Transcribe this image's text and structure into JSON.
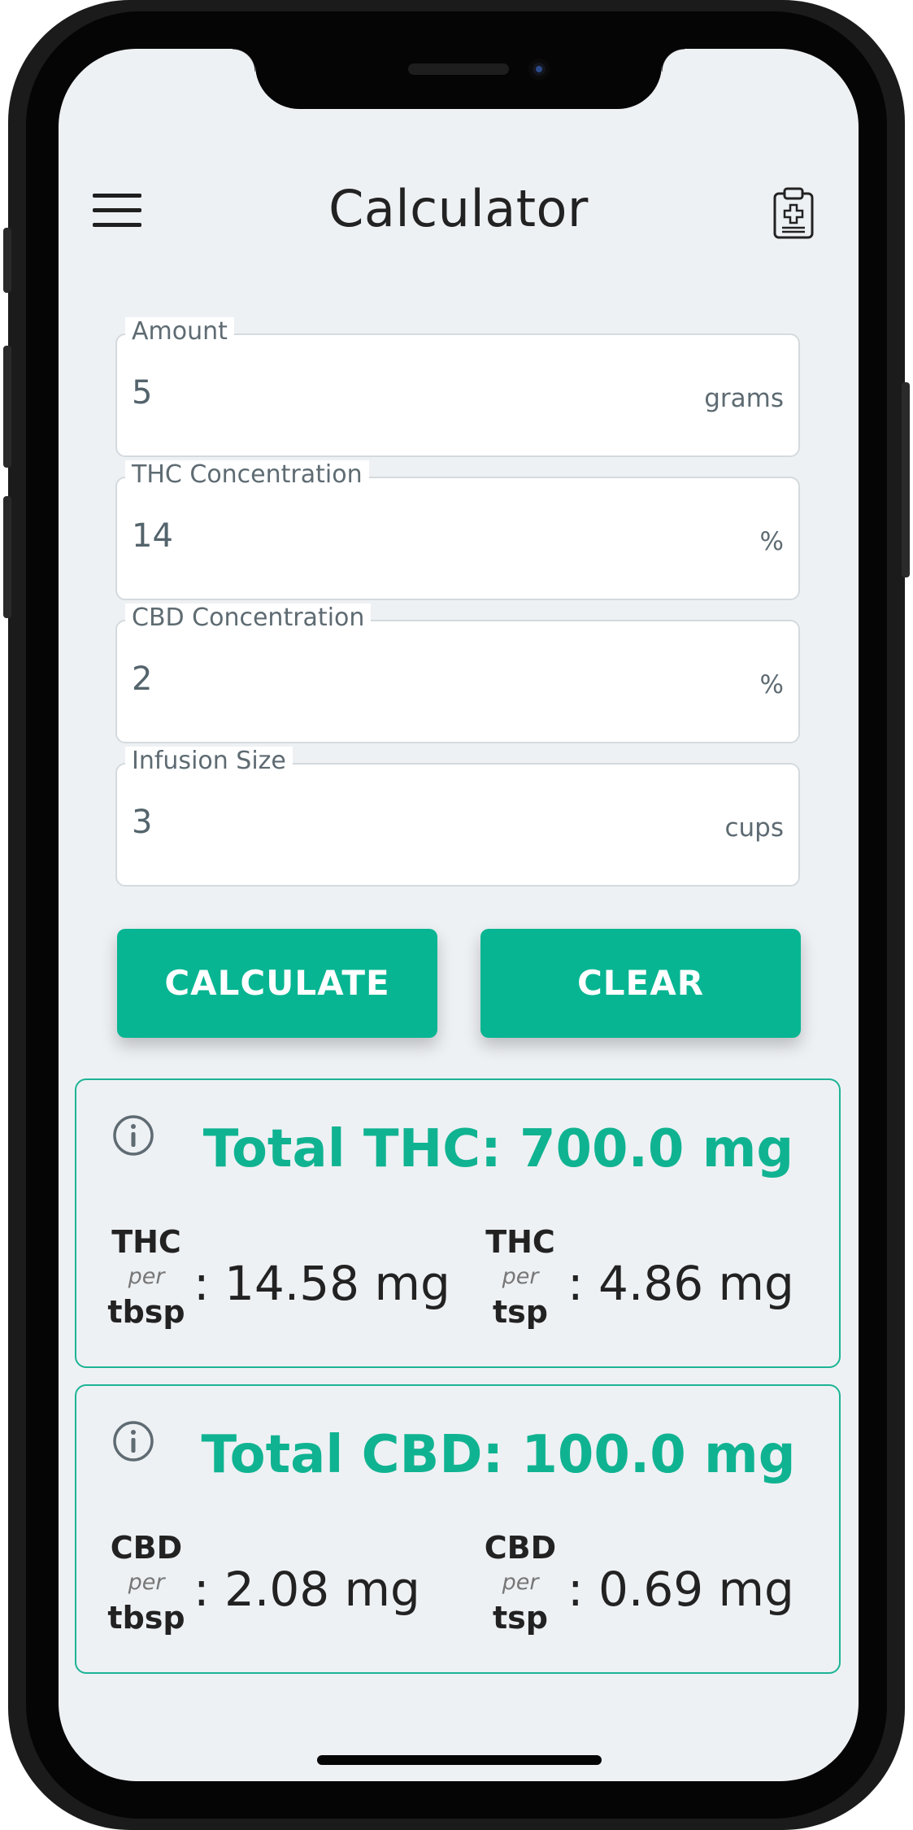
{
  "header": {
    "title": "Calculator",
    "menu_icon": "hamburger-menu-icon",
    "right_icon": "medical-clipboard-icon"
  },
  "form": {
    "amount": {
      "label": "Amount",
      "value": "5",
      "unit": "grams"
    },
    "thc": {
      "label": "THC Concentration",
      "value": "14",
      "unit": "%"
    },
    "cbd": {
      "label": "CBD Concentration",
      "value": "2",
      "unit": "%"
    },
    "infusion": {
      "label": "Infusion Size",
      "value": "3",
      "unit": "cups"
    }
  },
  "actions": {
    "calculate": "CALCULATE",
    "clear": "CLEAR"
  },
  "results": {
    "thc": {
      "total": "Total THC: 700.0 mg",
      "tbsp": {
        "top": "THC",
        "per": "per",
        "bottom": "tbsp",
        "value": ": 14.58 mg"
      },
      "tsp": {
        "top": "THC",
        "per": "per",
        "bottom": "tsp",
        "value": ": 4.86 mg"
      }
    },
    "cbd": {
      "total": "Total CBD: 100.0 mg",
      "tbsp": {
        "top": "CBD",
        "per": "per",
        "bottom": "tbsp",
        "value": ": 2.08 mg"
      },
      "tsp": {
        "top": "CBD",
        "per": "per",
        "bottom": "tsp",
        "value": ": 0.69 mg"
      }
    }
  },
  "colors": {
    "accent": "#07b592",
    "background": "#eef1f4",
    "text": "#222222"
  }
}
